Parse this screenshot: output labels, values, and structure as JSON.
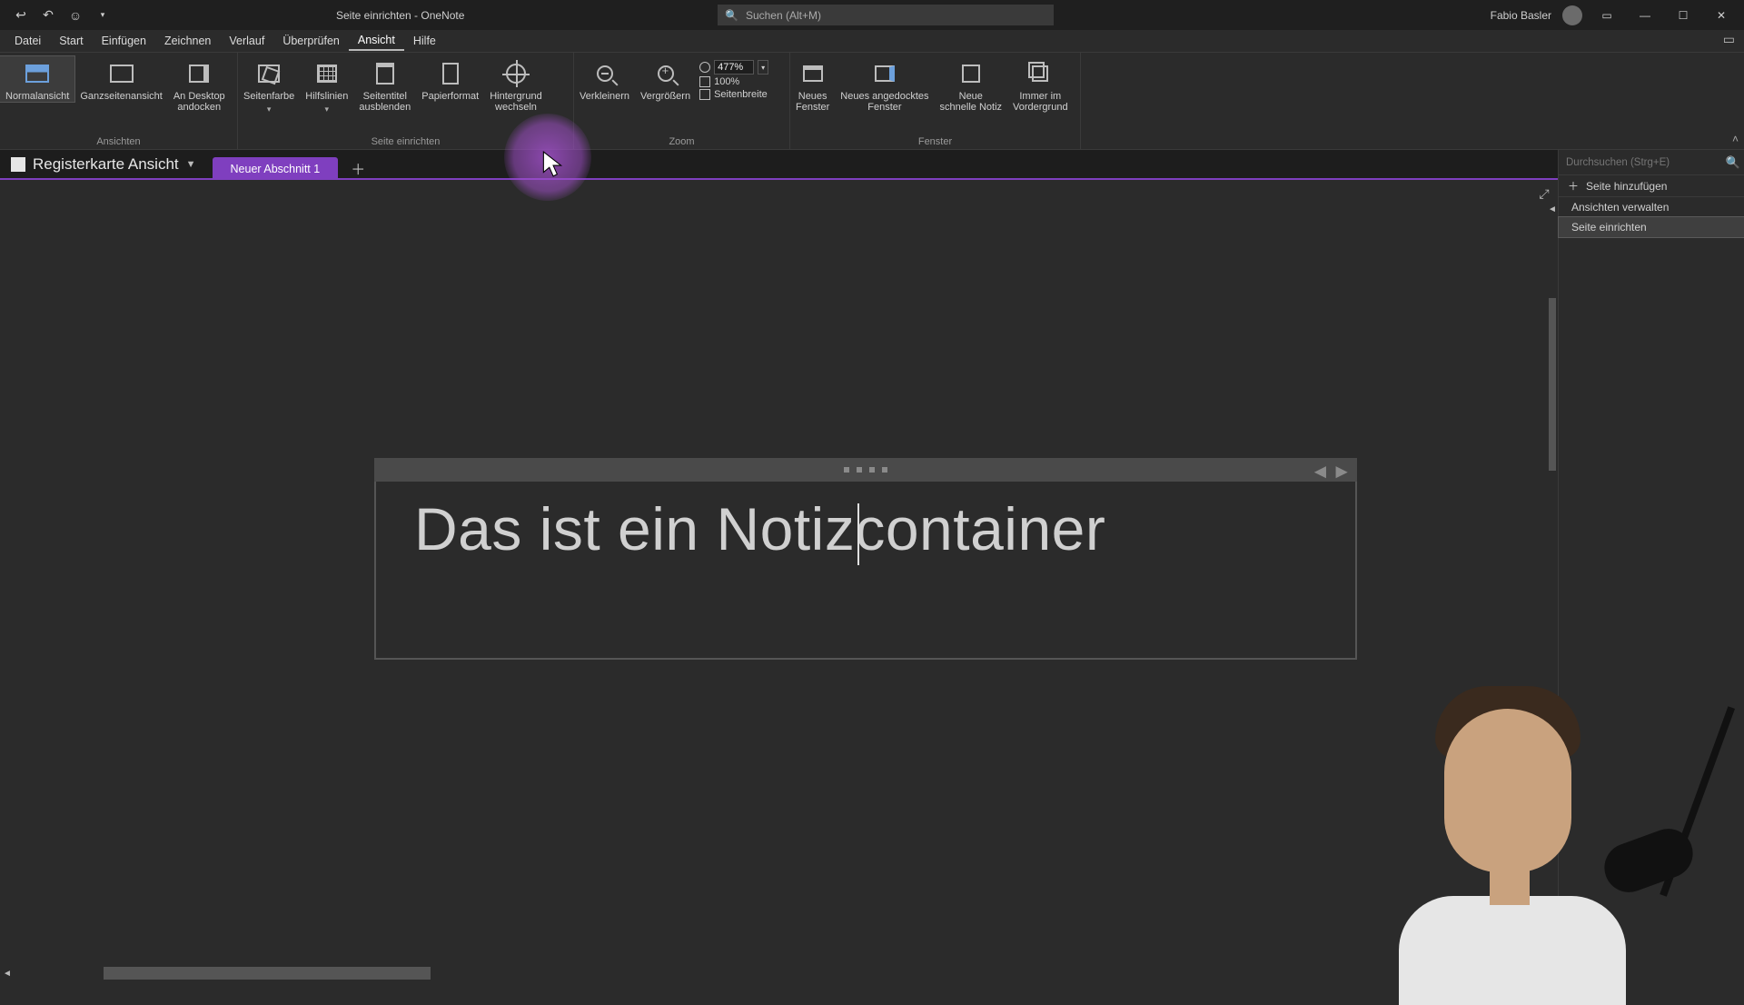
{
  "titlebar": {
    "doc": "Seite einrichten",
    "sep": "  -  ",
    "app": "OneNote",
    "search_placeholder": "Suchen (Alt+M)",
    "user": "Fabio Basler"
  },
  "menu": {
    "items": [
      "Datei",
      "Start",
      "Einfügen",
      "Zeichnen",
      "Verlauf",
      "Überprüfen",
      "Ansicht",
      "Hilfe"
    ],
    "active_index": 6
  },
  "ribbon": {
    "groups": {
      "ansichten": {
        "label": "Ansichten",
        "buttons": {
          "normal": "Normalansicht",
          "ganz": "Ganzseitenansicht",
          "dock": "An Desktop\nandocken"
        }
      },
      "seite": {
        "label": "Seite einrichten",
        "buttons": {
          "farbe": "Seitenfarbe",
          "hilfslinien": "Hilfslinien",
          "titel": "Seitentitel\nausblenden",
          "papier": "Papierformat",
          "hinter": "Hintergrund\nwechseln"
        }
      },
      "zoom": {
        "label": "Zoom",
        "buttons": {
          "out": "Verkleinern",
          "in": "Vergrößern"
        },
        "value": "477%",
        "preset100": "100%",
        "seitenbreite": "Seitenbreite"
      },
      "fenster": {
        "label": "Fenster",
        "buttons": {
          "neu": "Neues\nFenster",
          "angedockt": "Neues angedocktes\nFenster",
          "schnell": "Neue\nschnelle Notiz",
          "vorder": "Immer im\nVordergrund"
        }
      }
    }
  },
  "notebook": {
    "name": "Registerkarte Ansicht",
    "section_tab": "Neuer Abschnitt 1"
  },
  "page_pane": {
    "search_placeholder": "Durchsuchen (Strg+E)",
    "add_page": "Seite hinzufügen",
    "items": [
      "Ansichten verwalten",
      "Seite einrichten"
    ],
    "selected_index": 1
  },
  "note": {
    "text": "Das ist ein Notizcontainer"
  }
}
